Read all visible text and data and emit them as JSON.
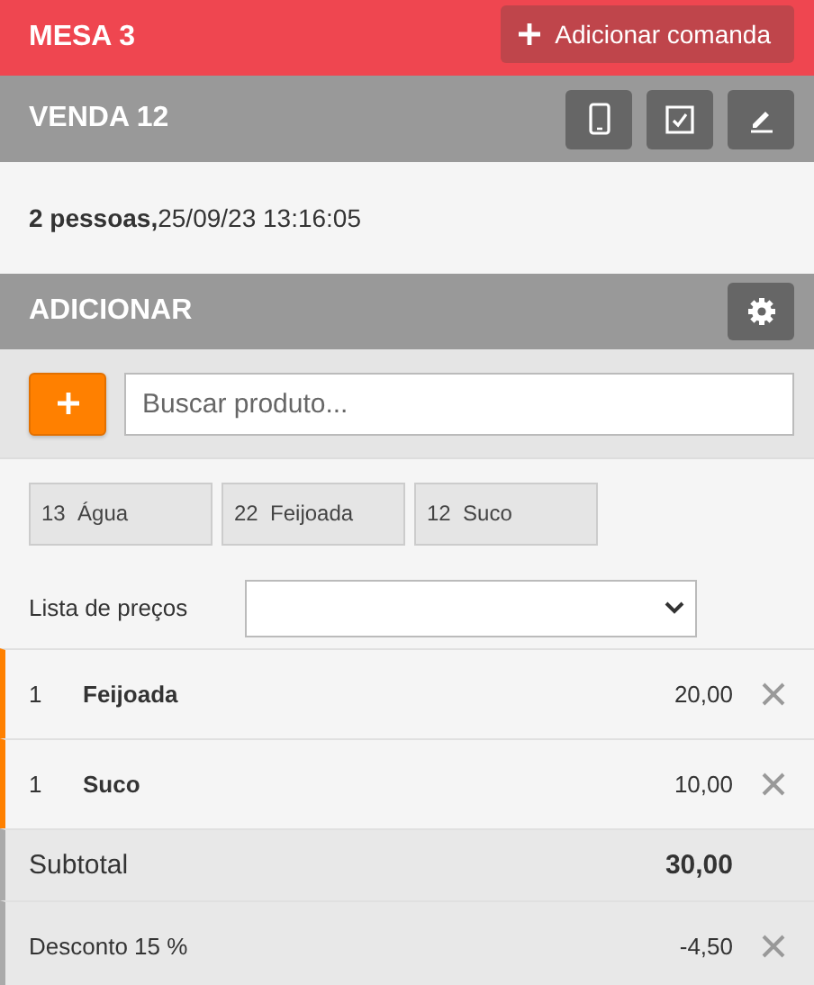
{
  "header": {
    "title": "MESA 3",
    "add_button": "Adicionar comanda"
  },
  "sale": {
    "title": "VENDA 12",
    "info": "**2 pessoas,**25/09/23 13:16:05"
  },
  "add_section": {
    "title": "ADICIONAR",
    "search": {
      "placeholder": "Buscar produto..."
    },
    "quick_products": [
      {
        "code": "13",
        "name": "Água"
      },
      {
        "code": "22",
        "name": "Feijoada"
      },
      {
        "code": "12",
        "name": "Suco"
      }
    ],
    "price_list": {
      "label": "Lista de preços"
    }
  },
  "lines": [
    {
      "kind": "item",
      "quantity": "1",
      "name": "Feijoada",
      "amount": "20,00",
      "removable": true
    },
    {
      "kind": "item",
      "quantity": "1",
      "name": "Suco",
      "amount": "10,00",
      "removable": true
    },
    {
      "kind": "subtotal",
      "name": "Subtotal",
      "amount": "30,00",
      "removable": false
    },
    {
      "kind": "discount",
      "name": "Desconto 15 %",
      "amount": "-4,50",
      "removable": true
    }
  ]
}
